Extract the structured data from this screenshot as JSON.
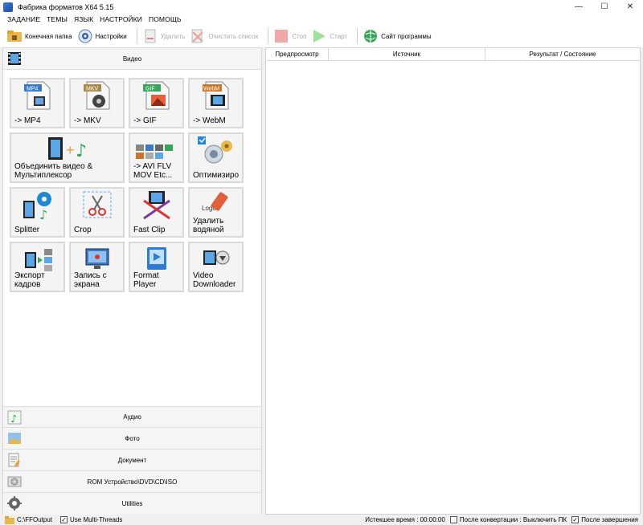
{
  "window": {
    "title": "Фабрика форматов X64 5.15",
    "controls": [
      "minimize",
      "maximize",
      "close"
    ]
  },
  "menu": [
    "ЗАДАНИЕ",
    "ТЕМЫ",
    "ЯЗЫК",
    "НАСТРОЙКИ",
    "ПОМОЩЬ"
  ],
  "toolbar": {
    "output_folder": "Конечная папка",
    "settings": "Настройки",
    "delete": "Удалить",
    "clear_list": "Очистить список",
    "stop": "Стоп",
    "start": "Старт",
    "website": "Сайт программы"
  },
  "categories": {
    "video": "Видео",
    "audio": "Аудио",
    "photo": "Фото",
    "document": "Документ",
    "rom": "ROM Устройство\\DVD\\CD\\ISO",
    "utilities": "Utilities"
  },
  "tiles": [
    {
      "label": "-> MP4",
      "icon": "mp4-file-icon",
      "badge": "MP4"
    },
    {
      "label": "-> MKV",
      "icon": "mkv-file-icon",
      "badge": "MKV"
    },
    {
      "label": "-> GIF",
      "icon": "gif-file-icon",
      "badge": "GIF"
    },
    {
      "label": "-> WebM",
      "icon": "webm-file-icon",
      "badge": "WebM"
    },
    {
      "label": "Объединить видео &\nМультиплексор",
      "icon": "merge-video-icon"
    },
    {
      "label": "-> AVI FLV\nMOV Etc...",
      "icon": "other-formats-icon"
    },
    {
      "label": "Оптимизиро",
      "icon": "optimize-icon"
    },
    {
      "label": "Splitter",
      "icon": "splitter-icon"
    },
    {
      "label": "Crop",
      "icon": "crop-icon"
    },
    {
      "label": "Fast Clip",
      "icon": "fast-clip-icon"
    },
    {
      "label": "Удалить\nводяной",
      "icon": "remove-watermark-icon",
      "badge": "Logo"
    },
    {
      "label": "Экспорт\nкадров",
      "icon": "export-frames-icon"
    },
    {
      "label": "Запись с\nэкрана",
      "icon": "screen-record-icon"
    },
    {
      "label": "Format\nPlayer",
      "icon": "format-player-icon"
    },
    {
      "label": "Video\nDownloader",
      "icon": "video-downloader-icon"
    }
  ],
  "table": {
    "columns": [
      "Предпросмотр",
      "Источник",
      "Результат / Состояние"
    ],
    "rows": []
  },
  "status": {
    "output_path": "C:\\FFOutput",
    "multithreads": "Use Multi-Threads",
    "elapsed": "Истекшее время : 00:00:00",
    "after_convert": "После конвертации : Выключить ПК",
    "after_done": "После завершения"
  },
  "colors": {
    "accent": "#2e7bd6",
    "stop": "#e88",
    "start": "#7c7"
  }
}
